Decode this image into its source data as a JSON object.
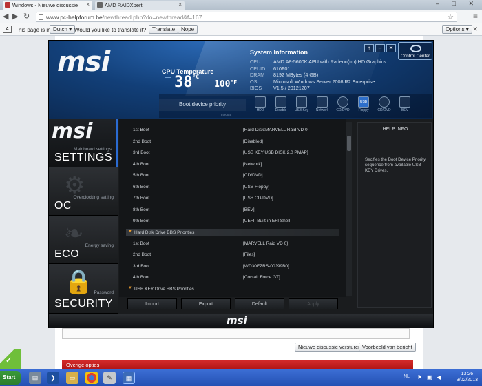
{
  "browser": {
    "tabs": [
      {
        "label": "Windows - Nieuwe discussie"
      },
      {
        "label": "AMD RAIDXpert"
      }
    ],
    "url_host": "www.pc-helpforum.be",
    "url_path": "/newthread.php?do=newthread&f=167",
    "translate_bar": {
      "prefix": "This page is in",
      "language": "Dutch",
      "question": "Would you like to translate it?",
      "translate_label": "Translate",
      "nope_label": "Nope",
      "options_label": "Options"
    }
  },
  "page": {
    "preview_button": "Nieuwe discussie versturen",
    "preview_button2": "Voorbeeld van bericht",
    "options_bar": "Overige opties"
  },
  "msi": {
    "cpu_temp_label": "CPU Temperature",
    "temp_c": "38",
    "temp_c_unit": "°C",
    "temp_f": "100",
    "temp_f_unit": "°F",
    "sysinfo_title": "System Information",
    "sysinfo": [
      {
        "k": "CPU",
        "v": "AMD A8-5600K APU with Radeon(tm) HD Graphics"
      },
      {
        "k": "CPUID",
        "v": "610F01"
      },
      {
        "k": "DRAM",
        "v": "8192 MBytes (4 GB)"
      },
      {
        "k": "OS",
        "v": "Microsoft Windows Server 2008 R2 Enterprise"
      },
      {
        "k": "BIOS",
        "v": "V1.5 / 20121207"
      }
    ],
    "control_center": "Control Center",
    "boot_priority_label": "Boot device priority",
    "boot_devices": [
      "HDD",
      "Disable",
      "USB Key",
      "Network",
      "CD/DVD",
      "Floppy",
      "CD/DVD",
      "BEV"
    ],
    "boot_usb_mark": "USB",
    "device_label": "Device",
    "nav": [
      {
        "sub": "Mainboard settings",
        "title": "SETTINGS"
      },
      {
        "sub": "Overclocking setting",
        "title": "OC"
      },
      {
        "sub": "Energy saving",
        "title": "ECO"
      },
      {
        "sub": "Password",
        "title": "SECURITY"
      }
    ],
    "boot_list": [
      {
        "label": "1st Boot",
        "value": "[Hard Disk:MARVELL Raid VD 0]"
      },
      {
        "label": "2nd Boot",
        "value": "[Disabled]"
      },
      {
        "label": "3rd Boot",
        "value": "[USB KEY:USB DISK 2.0 PMAP]"
      },
      {
        "label": "4th Boot",
        "value": "[Network]"
      },
      {
        "label": "5th Boot",
        "value": "[CD/DVD]"
      },
      {
        "label": "6th Boot",
        "value": "[USB Floppy]"
      },
      {
        "label": "7th Boot",
        "value": "[USB CD/DVD]"
      },
      {
        "label": "8th Boot",
        "value": "[BEV]"
      },
      {
        "label": "9th Boot",
        "value": "[UEFI: Built-in EFI Shell]"
      }
    ],
    "hdd_group": "Hard Disk Drive BBS Priorities",
    "hdd_list": [
      {
        "label": "1st Boot",
        "value": "[MARVELL Raid VD 0]"
      },
      {
        "label": "2nd Boot",
        "value": "[Files]"
      },
      {
        "label": "3rd Boot",
        "value": "[WD30EZRS-00J99B0]"
      },
      {
        "label": "4th Boot",
        "value": "[Corsair Force GT]"
      }
    ],
    "usb_group": "USB KEY Drive BBS Priorities",
    "actions": [
      "Import",
      "Export",
      "Default",
      "Apply"
    ],
    "help_title": "HELP INFO",
    "help_text": "Secifies the Boot Device Priority sequence from available USB KEY Drives."
  },
  "taskbar": {
    "start": "Start",
    "lang": "NL",
    "time": "13:26",
    "date": "3/02/2013"
  }
}
